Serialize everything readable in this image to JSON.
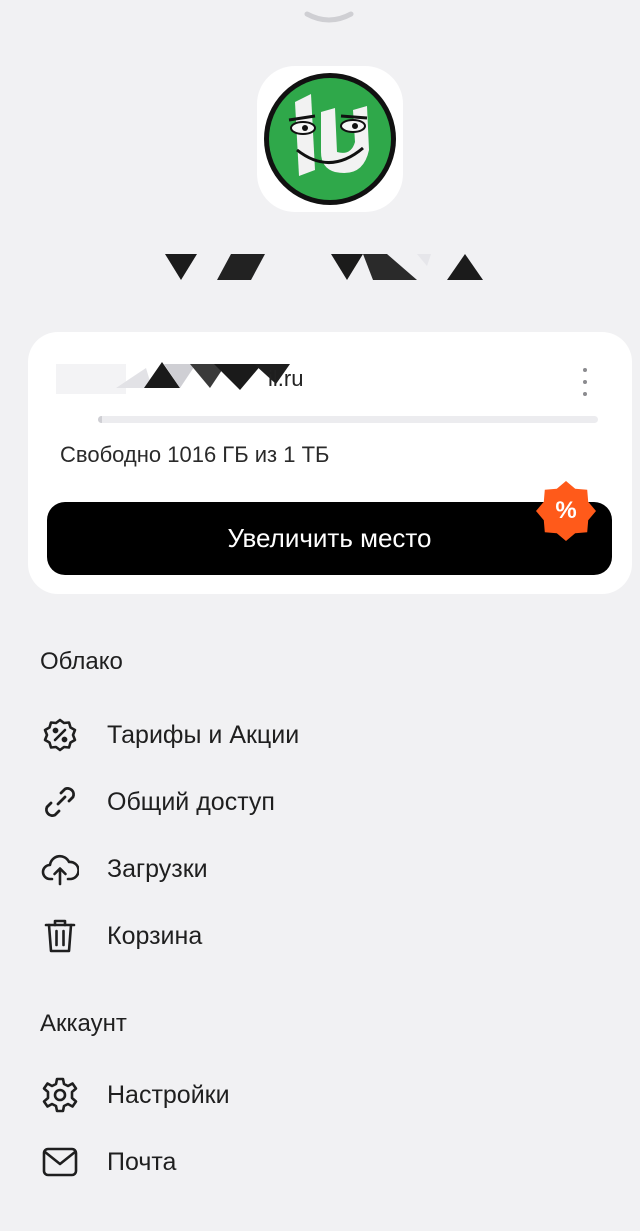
{
  "email": {
    "visible_suffix": "il.ru"
  },
  "storage": {
    "text": "Свободно 1016 ГБ из 1 ТБ",
    "used_fraction": 0.008
  },
  "cta": {
    "label": "Увеличить место"
  },
  "badge": {
    "symbol": "%"
  },
  "sections": {
    "cloud": {
      "title": "Облако",
      "items": [
        {
          "label": "Тарифы и Акции",
          "icon": "percent-badge-icon"
        },
        {
          "label": "Общий доступ",
          "icon": "link-icon"
        },
        {
          "label": "Загрузки",
          "icon": "cloud-upload-icon"
        },
        {
          "label": "Корзина",
          "icon": "trash-icon"
        }
      ]
    },
    "account": {
      "title": "Аккаунт",
      "items": [
        {
          "label": "Настройки",
          "icon": "gear-icon"
        },
        {
          "label": "Почта",
          "icon": "mail-icon"
        }
      ]
    }
  },
  "colors": {
    "background": "#f1f1f3",
    "cta": "#000000",
    "badge": "#ff5a1a",
    "avatar_green": "#2fa84a"
  }
}
